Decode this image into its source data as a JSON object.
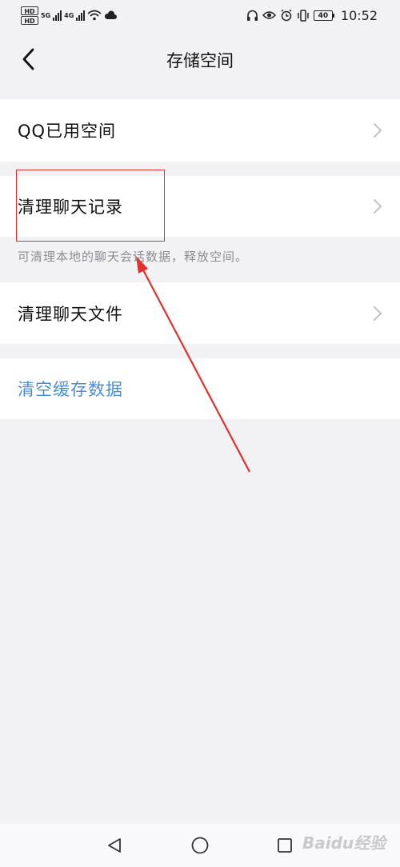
{
  "status_bar": {
    "hd1": "HD",
    "hd2": "HD",
    "net1": "5G",
    "net2": "4G",
    "battery": "40",
    "time": "10:52"
  },
  "nav": {
    "title": "存储空间"
  },
  "rows": {
    "qq_used": "QQ已用空间",
    "clear_chat_history": "清理聊天记录",
    "clear_chat_history_hint": "可清理本地的聊天会话数据，释放空间。",
    "clear_chat_files": "清理聊天文件",
    "clear_cache": "清空缓存数据"
  },
  "colors": {
    "background": "#f2f2f5",
    "row_bg": "#ffffff",
    "link_blue": "#4a8fd6",
    "annotation_red": "#e0312e",
    "hint_gray": "#8c8c95"
  },
  "watermark": "Baidu经验"
}
